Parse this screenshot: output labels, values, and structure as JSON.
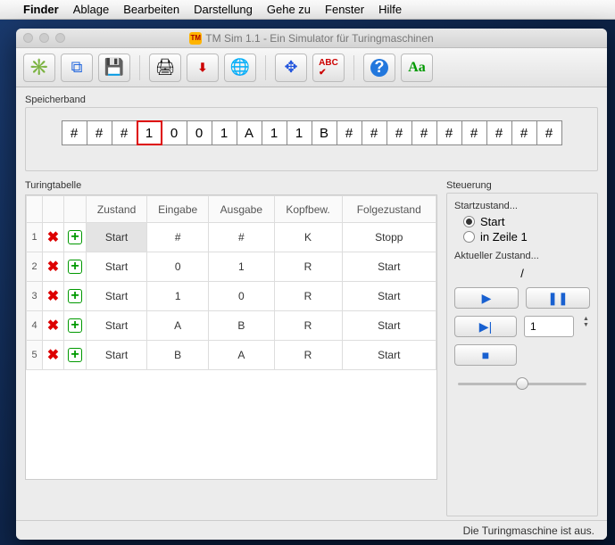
{
  "menubar": {
    "app": "Finder",
    "items": [
      "Ablage",
      "Bearbeiten",
      "Darstellung",
      "Gehe zu",
      "Fenster",
      "Hilfe"
    ]
  },
  "window": {
    "title": "TM Sim 1.1 - Ein Simulator für Turingmaschinen",
    "badge": "TM"
  },
  "sections": {
    "tape": "Speicherband",
    "table": "Turingtabelle",
    "controls": "Steuerung"
  },
  "tape": {
    "cells": [
      "#",
      "#",
      "#",
      "1",
      "0",
      "0",
      "1",
      "A",
      "1",
      "1",
      "B",
      "#",
      "#",
      "#",
      "#",
      "#",
      "#",
      "#",
      "#",
      "#"
    ],
    "head_index": 3
  },
  "table": {
    "headers": [
      "",
      "",
      "",
      "Zustand",
      "Eingabe",
      "Ausgabe",
      "Kopfbew.",
      "Folgezustand"
    ],
    "rows": [
      {
        "n": "1",
        "state": "Start",
        "in": "#",
        "out": "#",
        "move": "K",
        "next": "Stopp",
        "highlight": true
      },
      {
        "n": "2",
        "state": "Start",
        "in": "0",
        "out": "1",
        "move": "R",
        "next": "Start"
      },
      {
        "n": "3",
        "state": "Start",
        "in": "1",
        "out": "0",
        "move": "R",
        "next": "Start"
      },
      {
        "n": "4",
        "state": "Start",
        "in": "A",
        "out": "B",
        "move": "R",
        "next": "Start"
      },
      {
        "n": "5",
        "state": "Start",
        "in": "B",
        "out": "A",
        "move": "R",
        "next": "Start"
      }
    ]
  },
  "controls": {
    "start_label": "Startzustand...",
    "radio_start": "Start",
    "radio_line": "in Zeile 1",
    "current_label": "Aktueller Zustand...",
    "current_value": "/",
    "step_value": "1"
  },
  "status": "Die Turingmaschine ist aus."
}
